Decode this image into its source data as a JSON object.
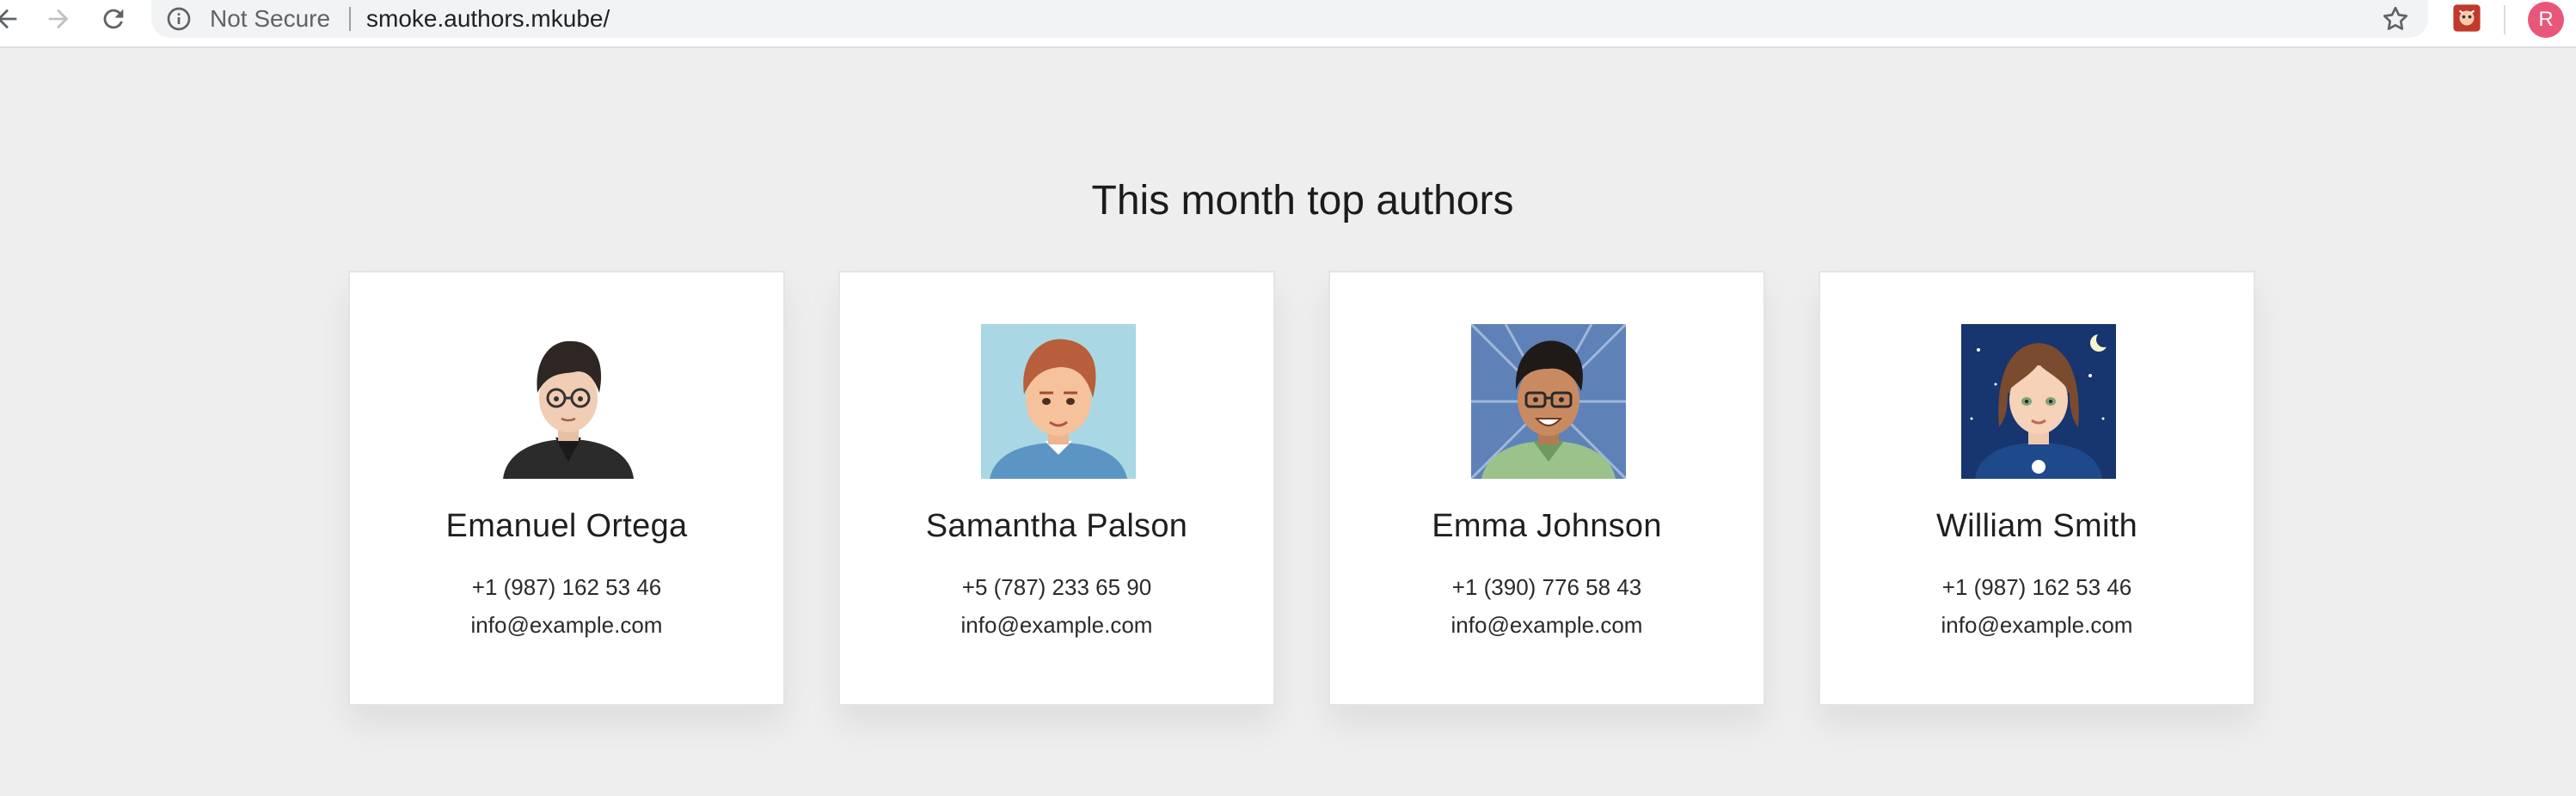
{
  "browser": {
    "security_label": "Not Secure",
    "url": "smoke.authors.mkube/",
    "profile_initial": "R",
    "colors": {
      "toolbar": "#ffffff",
      "omnibox": "#f1f3f4",
      "profile": "#e8577a"
    }
  },
  "page": {
    "title": "This month top authors",
    "background": "#eeeeee"
  },
  "authors": [
    {
      "name": "Emanuel Ortega",
      "phone": "+1 (987) 162 53 46",
      "email": "info@example.com",
      "avatar": "man-dark-hair-glasses-avatar"
    },
    {
      "name": "Samantha Palson",
      "phone": "+5 (787) 233 65 90",
      "email": "info@example.com",
      "avatar": "red-hair-man-avatar"
    },
    {
      "name": "Emma Johnson",
      "phone": "+1 (390) 776 58 43",
      "email": "info@example.com",
      "avatar": "man-glasses-green-shirt-avatar"
    },
    {
      "name": "William Smith",
      "phone": "+1 (987) 162 53 46",
      "email": "info@example.com",
      "avatar": "woman-brown-hair-night-avatar"
    }
  ]
}
